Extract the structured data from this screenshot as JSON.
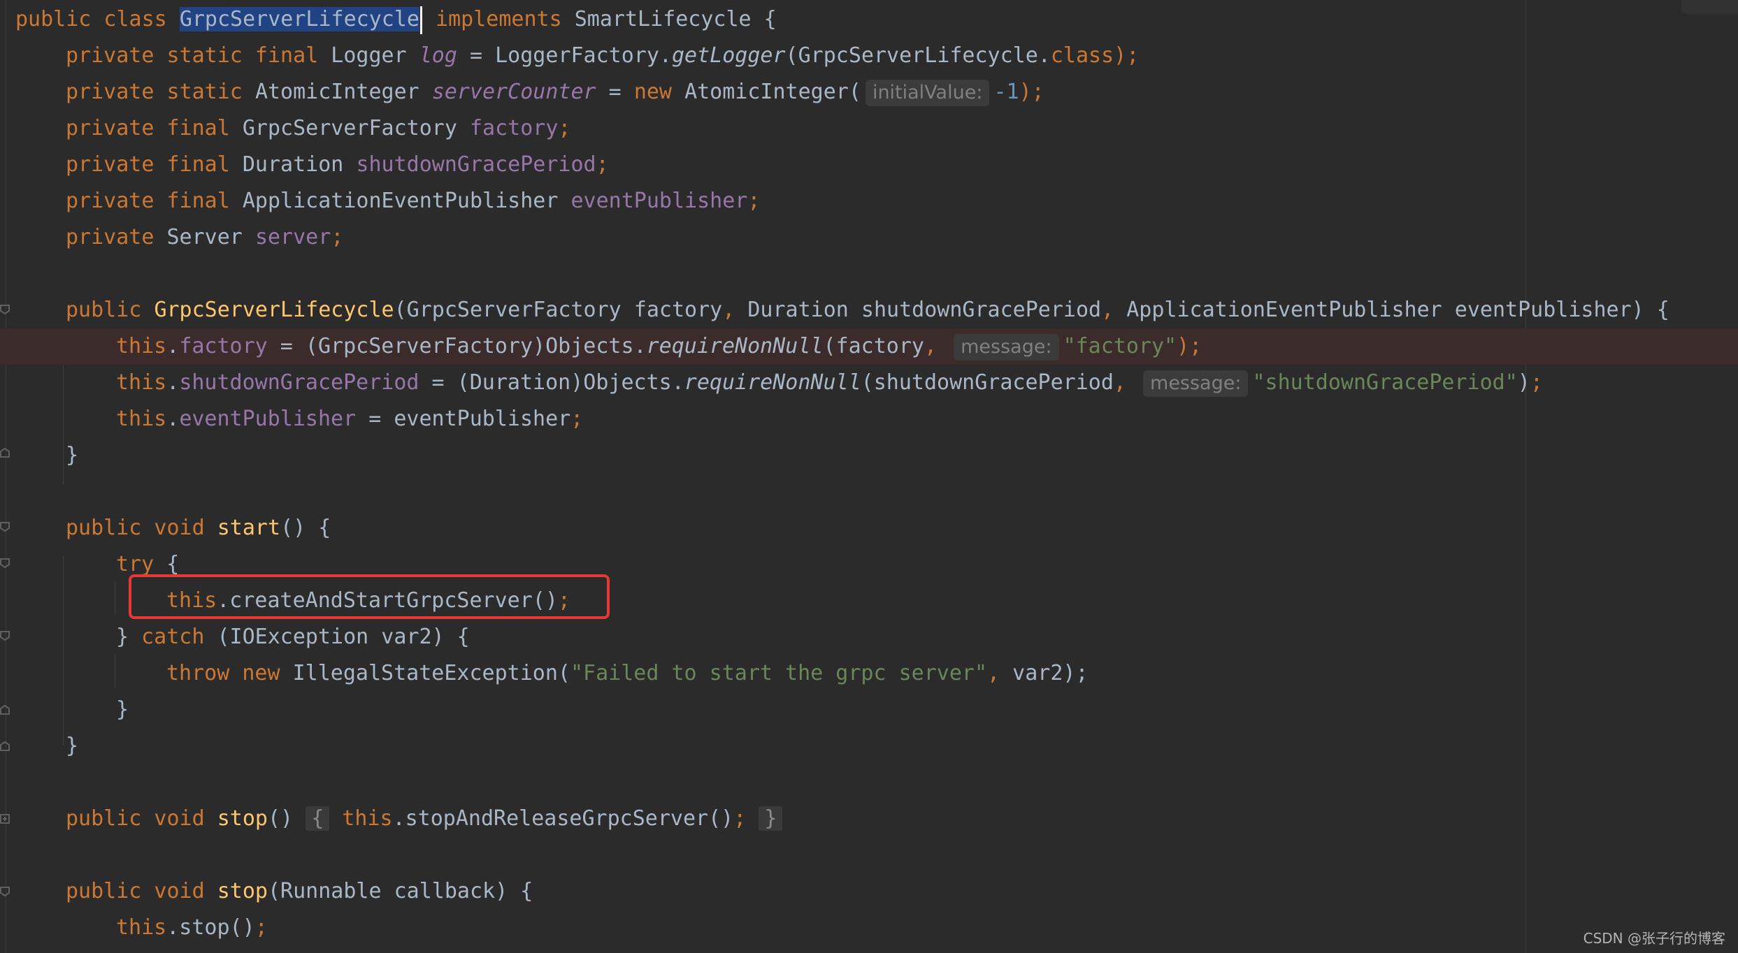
{
  "l1": {
    "a": "public class ",
    "b": "GrpcServerLifecycle",
    "c": " implements ",
    "d": "SmartLifecycle {"
  },
  "l2": {
    "a": "private static final ",
    "b": "Logger ",
    "c": "log",
    "d": " = LoggerFactory.",
    "e": "getLogger",
    "f": "(GrpcServerLifecycle.",
    "g": "class",
    "h": ");"
  },
  "l3": {
    "a": "private static ",
    "b": "AtomicInteger ",
    "c": "serverCounter",
    "d": " = ",
    "e": "new ",
    "f": "AtomicInteger(",
    "hint": "initialValue:",
    "g": "-1",
    "h": ");"
  },
  "l4": {
    "a": "private final ",
    "b": "GrpcServerFactory ",
    "c": "factory",
    ";": ";"
  },
  "l5": {
    "a": "private final ",
    "b": "Duration ",
    "c": "shutdownGracePeriod",
    ";": ";"
  },
  "l6": {
    "a": "private final ",
    "b": "ApplicationEventPublisher ",
    "c": "eventPublisher",
    ";": ";"
  },
  "l7": {
    "a": "private ",
    "b": "Server ",
    "c": "server",
    ";": ";"
  },
  "l9": {
    "a": "public ",
    "b": "GrpcServerLifecycle",
    "c": "(GrpcServerFactory factory",
    ",": ", ",
    "d": "Duration shutdownGracePeriod",
    "e": "ApplicationEventPublisher eventPublisher) {"
  },
  "l10": {
    "a": "this",
    "b": ".",
    "c": "factory",
    "d": " = (GrpcServerFactory)Objects.",
    "e": "requireNonNull",
    "f": "(factory",
    ",": ", ",
    "hint": "message:",
    "g": "\"factory\"",
    "h": ");"
  },
  "l11": {
    "a": "this",
    "b": ".",
    "c": "shutdownGracePeriod",
    "d": " = (Duration)Objects.",
    "e": "requireNonNull",
    "f": "(shutdownGracePeriod",
    ",": ", ",
    "hint": "message:",
    "g": "\"shutdownGracePeriod\"",
    "h": ")",
    ";": ";"
  },
  "l12": {
    "a": "this",
    "b": ".",
    "c": "eventPublisher",
    "d": " = eventPublisher",
    ";": ";"
  },
  "l13": {
    "a": "}"
  },
  "l15": {
    "a": "public void ",
    "b": "start",
    "c": "() {"
  },
  "l16": {
    "a": "try ",
    "b": "{"
  },
  "l17": {
    "a": "this",
    "b": ".createAndStartGrpcServer()",
    ";": ";"
  },
  "l18": {
    "a": "} ",
    "b": "catch ",
    "c": "(IOException var2) {"
  },
  "l19": {
    "a": "throw new ",
    "b": "IllegalStateException(",
    "c": "\"Failed to start the grpc server\"",
    ",": ", ",
    "d": "var2);"
  },
  "l20": {
    "a": "}"
  },
  "l21": {
    "a": "}"
  },
  "l23": {
    "a": "public void ",
    "b": "stop",
    "c": "() ",
    "d": "{",
    "e": " this",
    "f": ".stopAndReleaseGrpcServer()",
    ";": "; ",
    "g": "}"
  },
  "l25": {
    "a": "public void ",
    "b": "stop",
    "c": "(Runnable callback) {"
  },
  "l26": {
    "a": "this",
    "b": ".stop()",
    ";": ";"
  },
  "watermark": "CSDN @张子行的博客",
  "colors": {
    "background": "#2b2b2b",
    "keyword": "#cc7832",
    "method": "#ffc66d",
    "field": "#9876aa",
    "string": "#6a8759",
    "number": "#6897bb",
    "text": "#a9b7c6",
    "highlight_box": "#e53935"
  },
  "icons": [
    "fold-marker-icon"
  ]
}
